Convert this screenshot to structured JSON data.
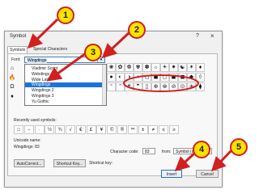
{
  "dialog": {
    "title": "Symbol",
    "help": "?",
    "close": "×"
  },
  "tabs": [
    "Symbols",
    "Special Characters"
  ],
  "font": {
    "label": "Font:",
    "selected": "Wingdings",
    "dropdown_icon": "chevron-down-icon",
    "list": [
      "Vladimir Script",
      "Webdings",
      "Wide Latin",
      "Wingdings",
      "Wingdings 2",
      "Wingdings 3",
      "Yu Gothic"
    ],
    "selected_index": 3
  },
  "left_glyphs": [
    "⌂",
    "🔥",
    "Ω",
    "♦"
  ],
  "grid_rows": [
    [
      "❀",
      "✿",
      "❁",
      "✾",
      "✽",
      "☼",
      "☀",
      "✷",
      "☯",
      "✶",
      "♦"
    ],
    [
      "●",
      "◐",
      "◑",
      "○",
      "◻",
      "◼",
      "◻",
      "◼",
      "◼",
      "◆",
      "◊"
    ],
    [
      "“",
      "”",
      "❝",
      "❞",
      "▯",
      "⊕",
      "⊗",
      "⊘",
      "⊙",
      "✳",
      "⧫"
    ]
  ],
  "recent": {
    "label": "Recently used symbols:",
    "symbols": [
      "□",
      "−",
      "·",
      "½",
      "¾",
      "√",
      "€",
      "£",
      "¥",
      "©",
      "®",
      "™",
      "±",
      "≠",
      "≤",
      "≥"
    ]
  },
  "unicode": {
    "label": "Unicode name:",
    "value": "Wingdings: 83"
  },
  "char_code": {
    "label": "Character code:",
    "value": "83"
  },
  "from": {
    "label": "from:",
    "value": "Symbol (decimal)"
  },
  "buttons": {
    "autocorrect": "AutoCorrect...",
    "shortcut": "Shortcut Key...",
    "shortcut_label": "Shortcut key:",
    "insert": "Insert",
    "cancel": "Cancel"
  },
  "callouts": [
    "1",
    "2",
    "3",
    "4",
    "5"
  ],
  "colors": {
    "callout_fill": "#ffe200",
    "arrow": "#d02020",
    "selection": "#1e73d6"
  }
}
